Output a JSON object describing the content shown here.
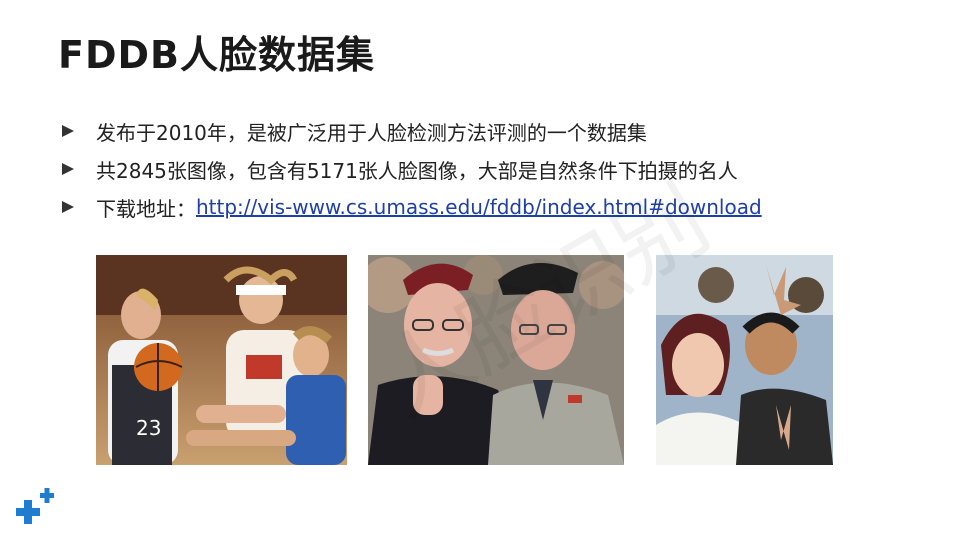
{
  "slide": {
    "title": "FDDB人脸数据集",
    "bullets": [
      {
        "text": "发布于2010年，是被广泛用于人脸检测方法评测的一个数据集"
      },
      {
        "text": "共2845张图像，包含有5171张人脸图像，大部是自然条件下拍摄的名人"
      },
      {
        "prefix": "下载地址：",
        "link": "http://vis-www.cs.umass.edu/fddb/index.html#download"
      }
    ],
    "photos": [
      {
        "name": "basketball-players-photo",
        "jersey_number": "23"
      },
      {
        "name": "officials-photo"
      },
      {
        "name": "crowd-selfie-photo"
      }
    ],
    "watermark": "人脸识别",
    "accent_color": "#1f7ccf"
  }
}
